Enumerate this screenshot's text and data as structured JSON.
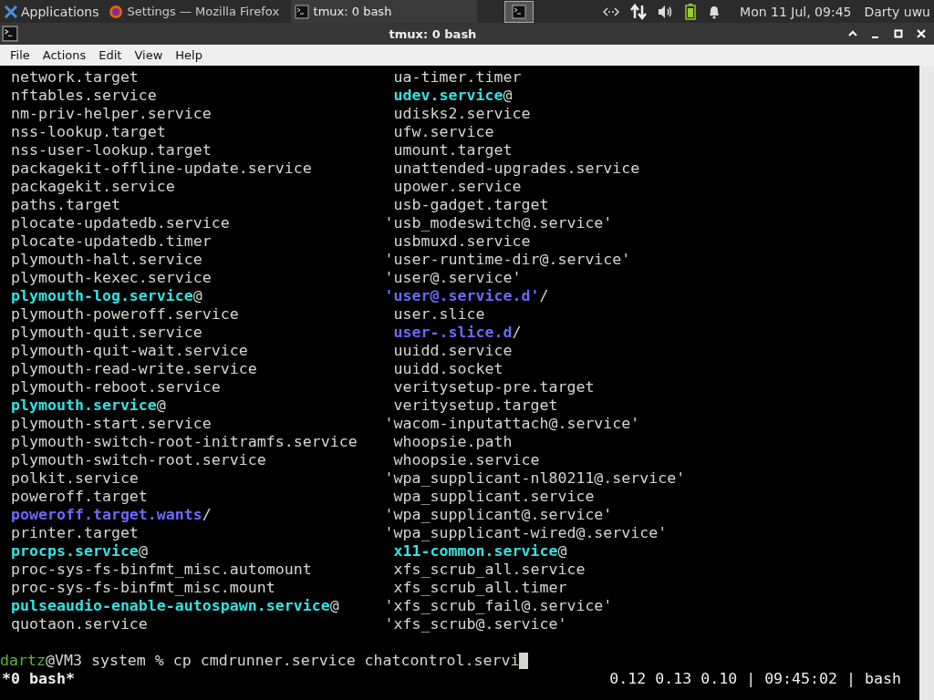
{
  "panel": {
    "menu_label": "Applications",
    "tasks": [
      {
        "label": "Settings — Mozilla Firefox",
        "kind": "browser",
        "selected": false
      },
      {
        "label": "tmux: 0 bash",
        "kind": "terminal",
        "selected": true
      }
    ],
    "clock": "Mon 11 Jul, 09:45",
    "user": "Darty uwu"
  },
  "window": {
    "title": "tmux: 0 bash"
  },
  "menu": [
    "File",
    "Actions",
    "Edit",
    "View",
    "Help"
  ],
  "listing": [
    [
      {
        "name": "network.target",
        "kind": "file"
      },
      {
        "name": "nftables.service",
        "kind": "file"
      },
      {
        "name": "nm-priv-helper.service",
        "kind": "file"
      },
      {
        "name": "nss-lookup.target",
        "kind": "file"
      },
      {
        "name": "nss-user-lookup.target",
        "kind": "file"
      },
      {
        "name": "packagekit-offline-update.service",
        "kind": "file"
      },
      {
        "name": "packagekit.service",
        "kind": "file"
      },
      {
        "name": "paths.target",
        "kind": "file"
      },
      {
        "name": "plocate-updatedb.service",
        "kind": "file"
      },
      {
        "name": "plocate-updatedb.timer",
        "kind": "file"
      },
      {
        "name": "plymouth-halt.service",
        "kind": "file"
      },
      {
        "name": "plymouth-kexec.service",
        "kind": "file"
      },
      {
        "name": "plymouth-log.service",
        "kind": "link",
        "suffix": "@"
      },
      {
        "name": "plymouth-poweroff.service",
        "kind": "file"
      },
      {
        "name": "plymouth-quit.service",
        "kind": "file"
      },
      {
        "name": "plymouth-quit-wait.service",
        "kind": "file"
      },
      {
        "name": "plymouth-read-write.service",
        "kind": "file"
      },
      {
        "name": "plymouth-reboot.service",
        "kind": "file"
      },
      {
        "name": "plymouth.service",
        "kind": "link",
        "suffix": "@"
      },
      {
        "name": "plymouth-start.service",
        "kind": "file"
      },
      {
        "name": "plymouth-switch-root-initramfs.service",
        "kind": "file"
      },
      {
        "name": "plymouth-switch-root.service",
        "kind": "file"
      },
      {
        "name": "polkit.service",
        "kind": "file"
      },
      {
        "name": "poweroff.target",
        "kind": "file"
      },
      {
        "name": "poweroff.target.wants",
        "kind": "dir",
        "suffix": "/"
      },
      {
        "name": "printer.target",
        "kind": "file"
      },
      {
        "name": "procps.service",
        "kind": "link",
        "suffix": "@"
      },
      {
        "name": "proc-sys-fs-binfmt_misc.automount",
        "kind": "file"
      },
      {
        "name": "proc-sys-fs-binfmt_misc.mount",
        "kind": "file"
      },
      {
        "name": "pulseaudio-enable-autospawn.service",
        "kind": "link",
        "suffix": "@"
      },
      {
        "name": "quotaon.service",
        "kind": "file"
      }
    ],
    [
      {
        "name": " ua-timer.timer",
        "kind": "file"
      },
      {
        "name": " udev.service",
        "kind": "link",
        "suffix": "@"
      },
      {
        "name": " udisks2.service",
        "kind": "file"
      },
      {
        "name": " ufw.service",
        "kind": "file"
      },
      {
        "name": " umount.target",
        "kind": "file"
      },
      {
        "name": " unattended-upgrades.service",
        "kind": "file"
      },
      {
        "name": " upower.service",
        "kind": "file"
      },
      {
        "name": " usb-gadget.target",
        "kind": "file"
      },
      {
        "name": "'usb_modeswitch@.service'",
        "kind": "file"
      },
      {
        "name": " usbmuxd.service",
        "kind": "file"
      },
      {
        "name": "'user-runtime-dir@.service'",
        "kind": "file"
      },
      {
        "name": "'user@.service'",
        "kind": "file"
      },
      {
        "name": "'user@.service.d'",
        "kind": "dir",
        "suffix": "/"
      },
      {
        "name": " user.slice",
        "kind": "file"
      },
      {
        "name": " user-.slice.d",
        "kind": "dir",
        "suffix": "/"
      },
      {
        "name": " uuidd.service",
        "kind": "file"
      },
      {
        "name": " uuidd.socket",
        "kind": "file"
      },
      {
        "name": " veritysetup-pre.target",
        "kind": "file"
      },
      {
        "name": " veritysetup.target",
        "kind": "file"
      },
      {
        "name": "'wacom-inputattach@.service'",
        "kind": "file"
      },
      {
        "name": " whoopsie.path",
        "kind": "file"
      },
      {
        "name": " whoopsie.service",
        "kind": "file"
      },
      {
        "name": "'wpa_supplicant-nl80211@.service'",
        "kind": "file"
      },
      {
        "name": " wpa_supplicant.service",
        "kind": "file"
      },
      {
        "name": "'wpa_supplicant@.service'",
        "kind": "file"
      },
      {
        "name": "'wpa_supplicant-wired@.service'",
        "kind": "file"
      },
      {
        "name": " x11-common.service",
        "kind": "link",
        "suffix": "@"
      },
      {
        "name": " xfs_scrub_all.service",
        "kind": "file"
      },
      {
        "name": " xfs_scrub_all.timer",
        "kind": "file"
      },
      {
        "name": "'xfs_scrub_fail@.service'",
        "kind": "file"
      },
      {
        "name": "'xfs_scrub@.service'",
        "kind": "file"
      }
    ]
  ],
  "prompt": {
    "user": "dartz",
    "context": "@VM3 system %",
    "command": "cp cmdrunner.service chatcontrol.servi"
  },
  "status": {
    "window": "*0 bash*",
    "info": "0.12 0.13 0.10 | 09:45:02 | bash"
  }
}
